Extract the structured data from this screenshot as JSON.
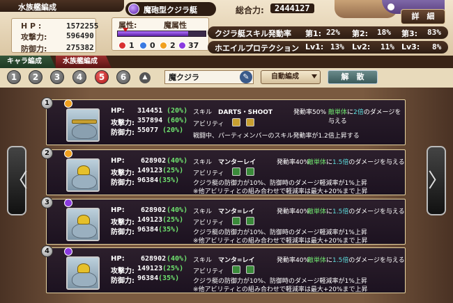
{
  "header": {
    "title": "水族艦編成",
    "stats": {
      "hp_label": "H P :",
      "hp_value": "1572255",
      "atk_label": "攻撃力:",
      "atk_value": "596490",
      "def_label": "防御力:",
      "def_value": "275382"
    },
    "ship_name": "魔砲型クジラ艇",
    "power_label": "総合力:",
    "power_value": "2444127",
    "attribute_label": "属性:",
    "attribute_value": "魔属性",
    "attribute_bar_fraction": 0.8,
    "orbs": [
      {
        "color": "#d83030",
        "count": "1"
      },
      {
        "color": "#3a7ae0",
        "count": "0"
      },
      {
        "color": "#f0a020",
        "count": "2"
      },
      {
        "color": "#8a3adf",
        "count": "37"
      }
    ],
    "skills": [
      {
        "name": "クジラ艇スキル発動率",
        "items": [
          {
            "label": "第1:",
            "value": "22%"
          },
          {
            "label": "第2:",
            "value": "18%"
          },
          {
            "label": "第3:",
            "value": "83%"
          }
        ]
      },
      {
        "name": "ホエイルプロテクション",
        "items": [
          {
            "label": "Lv1:",
            "value": "13%"
          },
          {
            "label": "Lv2:",
            "value": "11%"
          },
          {
            "label": "Lv3:",
            "value": "8%"
          }
        ]
      }
    ],
    "detail_button": "詳　細"
  },
  "tabs": [
    "キャラ編成",
    "水族艦編成"
  ],
  "slots": [
    "1",
    "2",
    "3",
    "4",
    "5",
    "6"
  ],
  "active_slot": "5",
  "up_label": "▲",
  "fleet_name": "魔クジラ",
  "auto_button": "自動編成",
  "dismiss_button": "解　散",
  "arrows": {
    "prev": "〈",
    "next": "〉"
  },
  "cards": [
    {
      "num": "1",
      "attr_color": "#f0a020",
      "hp_label": "HP:",
      "hp": "314451",
      "hp_pct": "(20%)",
      "atk_label": "攻撃力:",
      "atk": "357894",
      "atk_pct": "(60%)",
      "def_label": "防御力:",
      "def": "55077",
      "def_pct": "(20%)",
      "skill_label": "スキル",
      "skill_name": "DARTS・SHOOT",
      "skill_rate": "発動率50%",
      "skill_desc_1": "敵単体",
      "skill_desc_2": "に",
      "skill_desc_3": "2倍",
      "skill_desc_4": "のダメージを与える",
      "ability_label": "アビリティ",
      "ability_icon_color": "#c8a030",
      "desc1": "戦闘中、パーティメンバーのスキル発動率が1.2倍上昇する",
      "desc2": ""
    },
    {
      "num": "2",
      "attr_color": "#f0a020",
      "hp_label": "HP:",
      "hp": "628902",
      "hp_pct": "(40%)",
      "atk_label": "攻撃力:",
      "atk": "149123",
      "atk_pct": "(25%)",
      "def_label": "防御力:",
      "def": "96384",
      "def_pct": "(35%)",
      "skill_label": "スキル",
      "skill_name": "マンターレイ",
      "skill_rate": "発動率40%",
      "skill_desc_1": "敵単体",
      "skill_desc_2": "に",
      "skill_desc_3": "1.5倍",
      "skill_desc_4": "のダメージを与える",
      "ability_label": "アビリティ",
      "ability_icon_color": "#3a8a3a",
      "desc1": "クジラ艇の防御力が10%、防御時のダメージ軽減率が1%上昇",
      "desc2": "※他アビリティとの組み合わせで軽減率は最大+20%まで上昇"
    },
    {
      "num": "3",
      "attr_color": "#8a3adf",
      "hp_label": "HP:",
      "hp": "628902",
      "hp_pct": "(40%)",
      "atk_label": "攻撃力:",
      "atk": "149123",
      "atk_pct": "(25%)",
      "def_label": "防御力:",
      "def": "96384",
      "def_pct": "(35%)",
      "skill_label": "スキル",
      "skill_name": "マンタ=レイ",
      "skill_rate": "発動率40%",
      "skill_desc_1": "敵単体",
      "skill_desc_2": "に",
      "skill_desc_3": "1.5倍",
      "skill_desc_4": "のダメージを与える",
      "ability_label": "アビリティ",
      "ability_icon_color": "#3a8a3a",
      "desc1": "クジラ艇の防御力が10%、防御時のダメージ軽減率が1%上昇",
      "desc2": "※他アビリティとの組み合わせで軽減率は最大+20%まで上昇"
    },
    {
      "num": "4",
      "attr_color": "#8a3adf",
      "hp_label": "HP:",
      "hp": "628902",
      "hp_pct": "(40%)",
      "atk_label": "攻撃力:",
      "atk": "149123",
      "atk_pct": "(25%)",
      "def_label": "防御力:",
      "def": "96384",
      "def_pct": "(35%)",
      "skill_label": "スキル",
      "skill_name": "マンタ=レイ",
      "skill_rate": "発動率40%",
      "skill_desc_1": "敵単体",
      "skill_desc_2": "に",
      "skill_desc_3": "1.5倍",
      "skill_desc_4": "のダメージを与える",
      "ability_label": "アビリティ",
      "ability_icon_color": "#3a8a3a",
      "desc1": "クジラ艇の防御力が10%、防御時のダメージ軽減率が1%上昇",
      "desc2": "※他アビリティとの組み合わせで軽減率は最大+20%まで上昇"
    }
  ]
}
